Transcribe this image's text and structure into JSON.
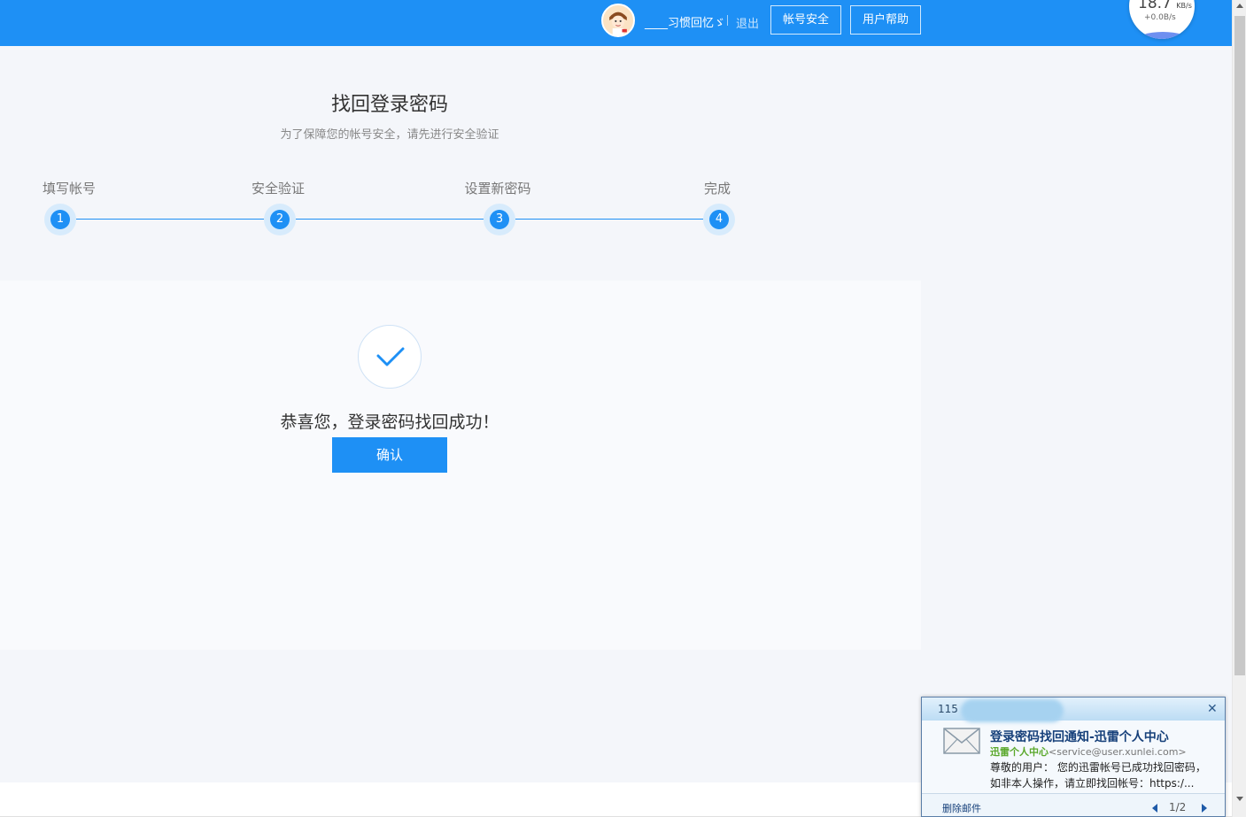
{
  "header": {
    "username": "____习惯回忆ゞ",
    "logout": "退出",
    "account_security": "帐号安全",
    "user_help": "用户帮助"
  },
  "speed_widget": {
    "download": "18.7",
    "download_unit": "KB/s",
    "upload": "+0.0B/s"
  },
  "page": {
    "title": "找回登录密码",
    "subtitle": "为了保障您的帐号安全，请先进行安全验证"
  },
  "steps": [
    {
      "label": "填写帐号",
      "number": "1"
    },
    {
      "label": "安全验证",
      "number": "2"
    },
    {
      "label": "设置新密码",
      "number": "3"
    },
    {
      "label": "完成",
      "number": "4"
    }
  ],
  "result": {
    "message": "恭喜您，登录密码找回成功！",
    "confirm": "确认"
  },
  "notification": {
    "account": "115",
    "subject": "登录密码找回通知-迅雷个人中心",
    "sender_name": "迅雷个人中心",
    "sender_email": "<service@user.xunlei.com>",
    "body_line1": "尊敬的用户： 您的迅雷帐号已成功找回密码，",
    "body_line2": "如非本人操作，请立即找回帐号：https:/...",
    "delete": "删除邮件",
    "page": "1/2"
  },
  "colors": {
    "brand_blue": "#1e90f5",
    "step_ring": "#d7ebfc",
    "sender_green": "#5aa82b"
  },
  "icons": {
    "avatar": "cartoon-girl-avatar",
    "success": "check-icon",
    "mail": "envelope-icon",
    "close": "close-icon"
  }
}
